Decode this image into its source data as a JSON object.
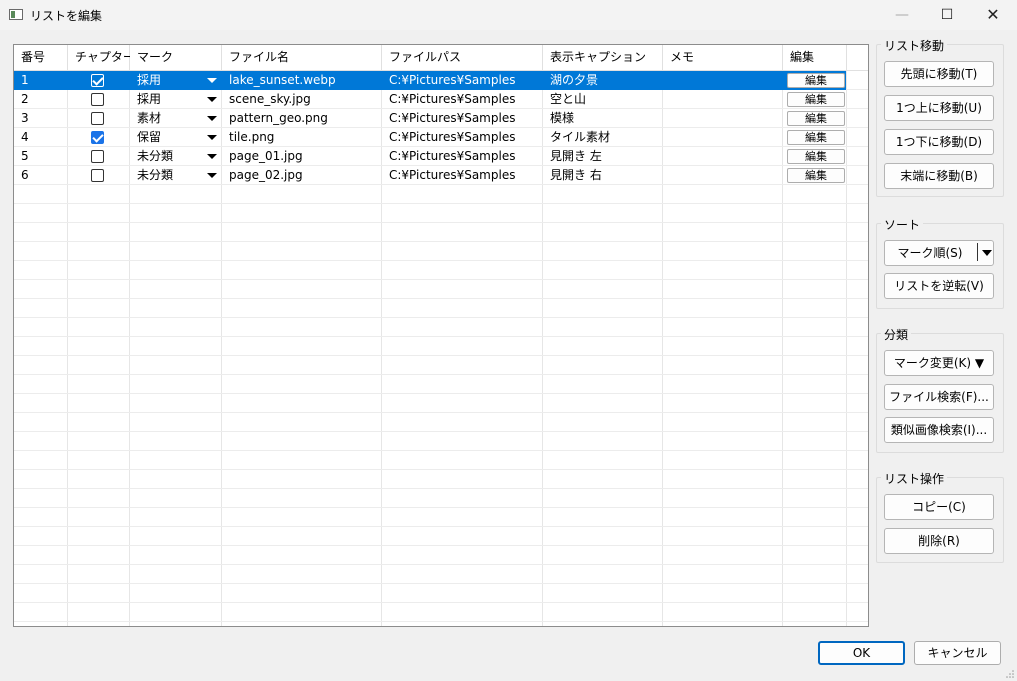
{
  "window": {
    "title": "リストを編集",
    "minimize_glyph": "—",
    "maximize_glyph": "☐",
    "close_glyph": "✕"
  },
  "table": {
    "headers": [
      "番号",
      "チャプター",
      "マーク",
      "ファイル名",
      "ファイルパス",
      "表示キャプション",
      "メモ",
      "編集"
    ],
    "rows": [
      {
        "num": "1",
        "chapter": true,
        "mark": "採用",
        "filename": "lake_sunset.webp",
        "path": "C:¥Pictures¥Samples",
        "caption": "湖の夕景",
        "memo": "",
        "edit": "編集",
        "selected": true
      },
      {
        "num": "2",
        "chapter": false,
        "mark": "採用",
        "filename": "scene_sky.jpg",
        "path": "C:¥Pictures¥Samples",
        "caption": "空と山",
        "memo": "",
        "edit": "編集",
        "selected": false
      },
      {
        "num": "3",
        "chapter": false,
        "mark": "素材",
        "filename": "pattern_geo.png",
        "path": "C:¥Pictures¥Samples",
        "caption": "模様",
        "memo": "",
        "edit": "編集",
        "selected": false
      },
      {
        "num": "4",
        "chapter": true,
        "mark": "保留",
        "filename": "tile.png",
        "path": "C:¥Pictures¥Samples",
        "caption": "タイル素材",
        "memo": "",
        "edit": "編集",
        "selected": false
      },
      {
        "num": "5",
        "chapter": false,
        "mark": "未分類",
        "filename": "page_01.jpg",
        "path": "C:¥Pictures¥Samples",
        "caption": "見開き 左",
        "memo": "",
        "edit": "編集",
        "selected": false
      },
      {
        "num": "6",
        "chapter": false,
        "mark": "未分類",
        "filename": "page_02.jpg",
        "path": "C:¥Pictures¥Samples",
        "caption": "見開き 右",
        "memo": "",
        "edit": "編集",
        "selected": false
      }
    ]
  },
  "panel": {
    "move": {
      "title": "リスト移動",
      "to_top": "先頭に移動(T)",
      "up": "1つ上に移動(U)",
      "down": "1つ下に移動(D)",
      "to_bottom": "末端に移動(B)"
    },
    "sort": {
      "title": "ソート",
      "by_mark": "マーク順(S)",
      "reverse": "リストを逆転(V)"
    },
    "classify": {
      "title": "分類",
      "change_mark": "マーク変更(K) ▼",
      "file_search": "ファイル検索(F)...",
      "similar_search": "類似画像検索(I)..."
    },
    "list_ops": {
      "title": "リスト操作",
      "copy": "コピー(C)",
      "delete": "削除(R)"
    }
  },
  "dialog": {
    "ok": "OK",
    "cancel": "キャンセル"
  },
  "colors": {
    "selection": "#0078d7",
    "checkbox_checked": "#1a73e8",
    "default_button_border": "#0067c0"
  }
}
